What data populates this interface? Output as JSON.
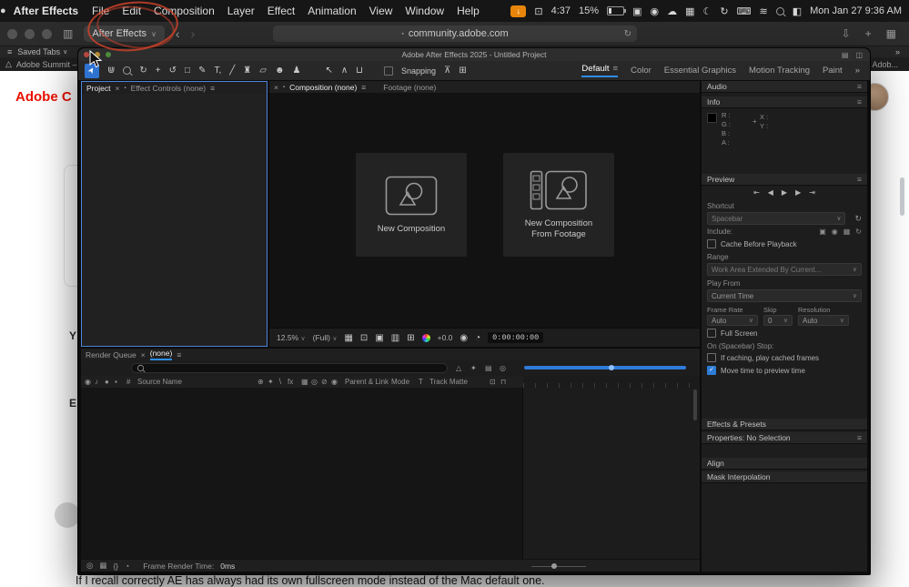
{
  "icons": {
    "apple": "●",
    "sidebar": "▥",
    "chev": "∨",
    "dbl": "»",
    "back": "‹",
    "fwd": "›",
    "shield": "▣",
    "refresh": "↻",
    "lockdot": "▪",
    "down": "⇩",
    "plus": "+",
    "tabs": "▦",
    "menu": "≡",
    "close": "×",
    "warning": "△",
    "badge": "↓",
    "crosshair": "+",
    "check": "✓",
    "cursor": "➤"
  },
  "menubar": {
    "app_name": "After Effects",
    "menus": [
      "File",
      "Edit",
      "Composition",
      "Layer",
      "Effect",
      "Animation",
      "View",
      "Window",
      "Help"
    ],
    "icons": [
      "⊡",
      "▣",
      "◉",
      "☁",
      "▦",
      "☾",
      "↻",
      "⌨",
      "≋",
      "◧"
    ],
    "time": "4:37",
    "battery": "15%",
    "clock": "Mon Jan 27 9:36 AM"
  },
  "safari": {
    "active_tab": "After Effects",
    "address": "community.adobe.com",
    "saved_tabs_label": "Saved Tabs",
    "left_page_tab": "Adobe Summit – Ti...",
    "right_page_tab": "– Adob..."
  },
  "page": {
    "logo_text": "Adobe C",
    "fragment_y": "Y",
    "fragment_e": "E",
    "comment_text": "If I recall correctly AE has always had its own fullscreen mode instead of the Mac default one."
  },
  "ae": {
    "window_title": "Adobe After Effects 2025 - Untitled Project",
    "title_icons": [
      "▤",
      "◫"
    ],
    "tools": [
      "⋓",
      "↻",
      "+",
      "↺",
      "□",
      "✎",
      "T,",
      "╱",
      "♜",
      "▱",
      "☻",
      "♟"
    ],
    "mid_icons": [
      "↖",
      "∧",
      "⊔"
    ],
    "snapping": "Snapping",
    "snap_icons": [
      "⊼",
      "⊞"
    ],
    "workspaces": [
      "Default",
      "Color",
      "Essential Graphics",
      "Motion Tracking",
      "Paint"
    ],
    "project_tab": "Project",
    "effect_controls_tab": "Effect Controls (none)",
    "composition_tab": "Composition (none)",
    "footage_tab": "Footage (none)",
    "new_comp": "New Composition",
    "new_comp_footage_1": "New Composition",
    "new_comp_footage_2": "From Footage",
    "zoom": "12.5%",
    "resolution": "(Full)",
    "comp_icons": [
      "▦",
      "⊡",
      "▣",
      "▥",
      "⊞"
    ],
    "cam": "◉",
    "pie": "◔",
    "exposure": "+0.0",
    "timecode": "0:00:00:00",
    "render_queue_tab": "Render Queue",
    "none_tab": "(none)",
    "rq_icons": [
      "△",
      "✦",
      "▤",
      "◎"
    ],
    "tl_head_icons": [
      "◉",
      "♪",
      "●",
      "▪"
    ],
    "sw_icons": [
      "⊕",
      "✦",
      "∖",
      "fx",
      "▦",
      "◎",
      "⊘",
      "◉"
    ],
    "col_hash": "#",
    "col_source": "Source Name",
    "col_parent": "Parent & Link",
    "col_mode": "Mode",
    "col_t": "T",
    "col_matte": "Track Matte",
    "colx": [
      "⊡",
      "⊓"
    ],
    "tlb_icons": [
      "◎",
      "▦",
      "{}",
      "◔"
    ],
    "frame_render_label": "Frame Render Time:",
    "frame_render_value": "0ms",
    "transport": [
      "⇤",
      "◀",
      "▶",
      "▶",
      "⇥"
    ],
    "inc_icons": [
      "▣",
      "◉",
      "▦"
    ],
    "right": {
      "audio": "Audio",
      "info": "Info",
      "r": "R :",
      "g": "G :",
      "b": "B :",
      "a": "A :",
      "x": "X :",
      "y": "Y :",
      "preview": "Preview",
      "shortcut": "Shortcut",
      "spacebar": "Spacebar",
      "include": "Include:",
      "cache": "Cache Before Playback",
      "range": "Range",
      "range_value": "Work Area Extended By Current...",
      "play_from": "Play From",
      "current_time": "Current Time",
      "frame_rate": "Frame Rate",
      "skip": "Skip",
      "resolution_label": "Resolution",
      "frame_rate_value": "Auto",
      "skip_value": "0",
      "resolution_value": "Auto",
      "full_screen": "Full Screen",
      "stop": "On (Spacebar) Stop:",
      "caching": "If caching, play cached frames",
      "move_time": "Move time to preview time",
      "effects": "Effects & Presets",
      "properties": "Properties: No Selection",
      "align": "Align",
      "mask": "Mask Interpolation"
    }
  }
}
